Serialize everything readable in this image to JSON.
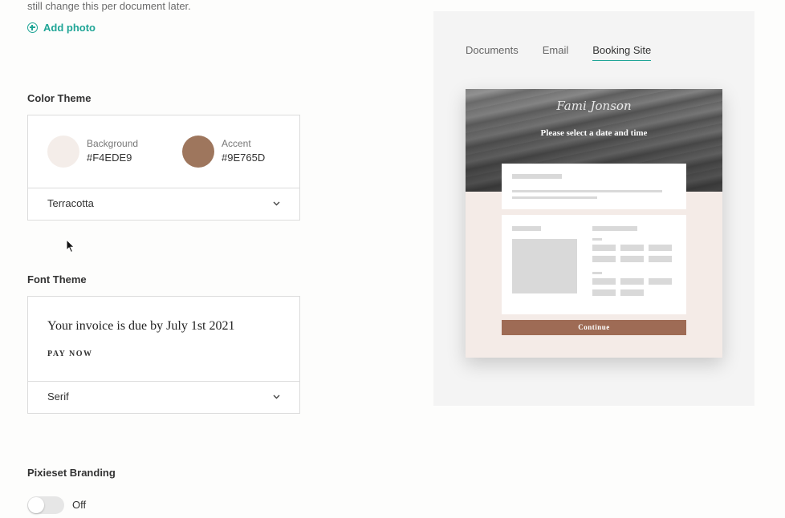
{
  "intro": {
    "text": "still change this per document later."
  },
  "add_photo": {
    "label": "Add photo",
    "icon": "plus-circle-icon"
  },
  "color_theme": {
    "title": "Color Theme",
    "background": {
      "label": "Background",
      "value": "#F4EDE9",
      "color": "#F4EDE9"
    },
    "accent": {
      "label": "Accent",
      "value": "#9E765D",
      "color": "#9E765D"
    },
    "selected": "Terracotta"
  },
  "font_theme": {
    "title": "Font Theme",
    "sample_text": "Your invoice is due by July 1st 2021",
    "cta_text": "PAY NOW",
    "selected": "Serif"
  },
  "branding": {
    "title": "Pixieset Branding",
    "toggle_label": "Off"
  },
  "preview": {
    "tabs": [
      {
        "label": "Documents",
        "active": false
      },
      {
        "label": "Email",
        "active": false
      },
      {
        "label": "Booking Site",
        "active": true
      }
    ],
    "logo_text": "Fami Jonson",
    "heading": "Please select a date and time",
    "button_label": "Continue"
  },
  "colors": {
    "accent_teal": "#1FA596",
    "mock_button": "#9E6B55",
    "mock_bg": "#F4EBE7"
  }
}
